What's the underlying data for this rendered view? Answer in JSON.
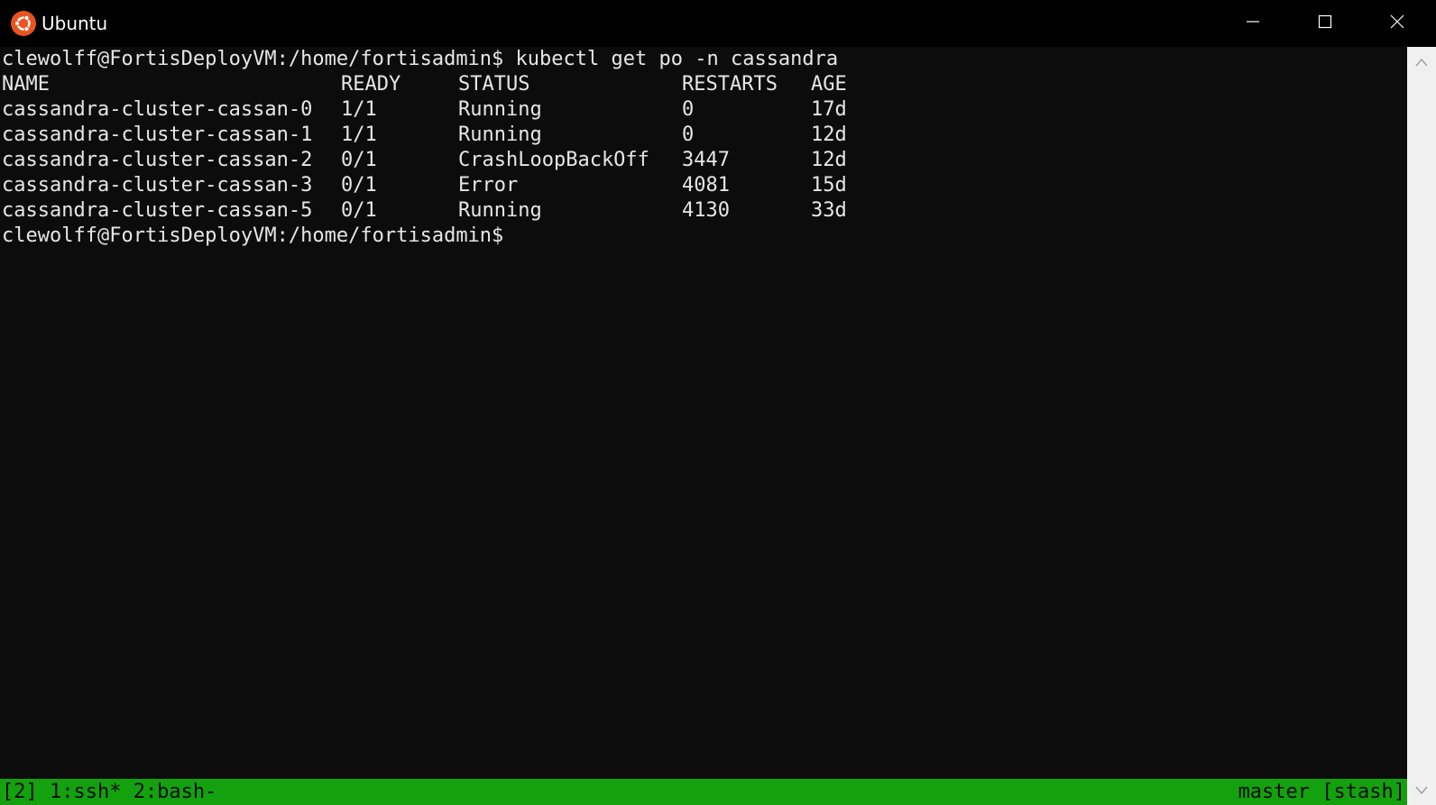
{
  "window": {
    "title": "Ubuntu",
    "icon": "ubuntu-logo",
    "accent_color": "#e95420"
  },
  "terminal": {
    "command_line": "clewolff@FortisDeployVM:/home/fortisadmin$ kubectl get po -n cassandra",
    "headers": {
      "name": "NAME",
      "ready": "READY",
      "status": "STATUS",
      "restarts": "RESTARTS",
      "age": "AGE"
    },
    "rows": [
      {
        "name": "cassandra-cluster-cassan-0",
        "ready": "1/1",
        "status": "Running",
        "restarts": "0",
        "age": "17d"
      },
      {
        "name": "cassandra-cluster-cassan-1",
        "ready": "1/1",
        "status": "Running",
        "restarts": "0",
        "age": "12d"
      },
      {
        "name": "cassandra-cluster-cassan-2",
        "ready": "0/1",
        "status": "CrashLoopBackOff",
        "restarts": "3447",
        "age": "12d"
      },
      {
        "name": "cassandra-cluster-cassan-3",
        "ready": "0/1",
        "status": "Error",
        "restarts": "4081",
        "age": "15d"
      },
      {
        "name": "cassandra-cluster-cassan-5",
        "ready": "0/1",
        "status": "Running",
        "restarts": "4130",
        "age": "33d"
      }
    ],
    "prompt": "clewolff@FortisDeployVM:/home/fortisadmin$",
    "background_color": "#0c0c0c",
    "text_color": "#e6e6e6"
  },
  "statusbar": {
    "left": "[2] 1:ssh* 2:bash-",
    "right": "master [stash]",
    "background_color": "#13a10e"
  }
}
